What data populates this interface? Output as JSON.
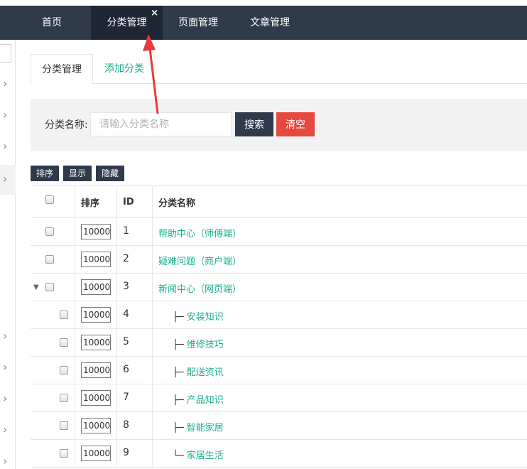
{
  "nav": {
    "tabs": [
      {
        "label": "首页"
      },
      {
        "label": "分类管理"
      },
      {
        "label": "页面管理"
      },
      {
        "label": "文章管理"
      }
    ],
    "close_glyph": "×"
  },
  "sub_tabs": [
    {
      "label": "分类管理"
    },
    {
      "label": "添加分类"
    }
  ],
  "search": {
    "label": "分类名称:",
    "placeholder": "请输入分类名称",
    "search_button": "搜索",
    "clear_button": "清空"
  },
  "toolbar": {
    "sort_button": "排序",
    "show_button": "显示",
    "hide_button": "隐藏"
  },
  "table": {
    "headers": {
      "sort": "排序",
      "id": "ID",
      "name": "分类名称"
    },
    "rows": [
      {
        "sort": "10000",
        "id": "1",
        "prefix": "",
        "name": "帮助中心（师傅端）"
      },
      {
        "sort": "10000",
        "id": "2",
        "prefix": "",
        "name": "疑难问题（商户端）"
      },
      {
        "sort": "10000",
        "id": "3",
        "prefix": "",
        "name": "新闻中心（网页端）"
      },
      {
        "sort": "10000",
        "id": "4",
        "prefix": "├─ ",
        "name": "安装知识"
      },
      {
        "sort": "10000",
        "id": "5",
        "prefix": "├─ ",
        "name": "维修技巧"
      },
      {
        "sort": "10000",
        "id": "6",
        "prefix": "├─ ",
        "name": "配送资讯"
      },
      {
        "sort": "10000",
        "id": "7",
        "prefix": "├─ ",
        "name": "产品知识"
      },
      {
        "sort": "10000",
        "id": "8",
        "prefix": "├─ ",
        "name": "智能家居"
      },
      {
        "sort": "10000",
        "id": "9",
        "prefix": "└─ ",
        "name": "家居生活"
      }
    ]
  },
  "icons": {
    "expand": "caret-down-icon",
    "sidebar_chevron": "chevron-right-icon",
    "annotation": "red-arrow"
  },
  "colors": {
    "header_bg": "#2f3a4a",
    "link": "#1aaf8e",
    "danger": "#e5483f",
    "arrow": "#e83a3a"
  }
}
